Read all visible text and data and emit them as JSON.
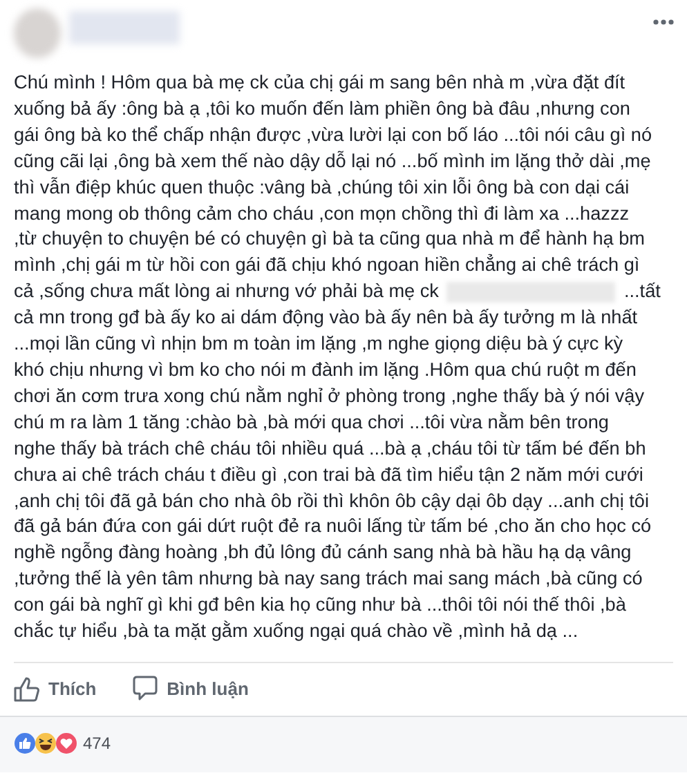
{
  "post": {
    "lines": [
      {
        "text": "Chú mình ! Hôm qua bà mẹ ck của chị gái m sang bên nhà m ,vừa đặt đít"
      },
      {
        "text": "xuống bả ấy :ông bà ạ ,tôi ko muốn đến làm phiền ông bà đâu ,nhưng con"
      },
      {
        "text": "gái ông bà ko thể chấp nhận được ,vừa lười lại con bố láo ...tôi nói câu gì nó"
      },
      {
        "text": "cũng cãi lại ,ông bà xem thế nào dậy dỗ lại nó ...bố mình im lặng thở dài ,mẹ"
      },
      {
        "text": "thì vẫn điệp khúc quen thuộc :vâng bà ,chúng tôi xin lỗi ông bà con dại cái"
      },
      {
        "text": "mang mong ob thông cảm cho cháu ,con mọn chồng thì đi làm xa ...hazzz"
      },
      {
        "text": ",từ chuyện to chuyện bé có chuyện gì bà ta cũng qua nhà m để hành hạ bm"
      },
      {
        "text": "mình ,chị gái m từ hồi con gái đã chịu khó ngoan hiền chẳng ai chê trách gì"
      },
      {
        "text": "cả ,sống chưa mất lòng ai nhưng vớ phải bà mẹ ck",
        "redacted": true,
        "text_after": "...tất"
      },
      {
        "text": "cả mn trong gđ bà ấy ko ai dám động vào bà ấy nên bà ấy tưởng m là nhất"
      },
      {
        "text": "...mọi lần cũng vì nhịn bm m toàn im lặng ,m nghe giọng diệu bà ý cực kỳ"
      },
      {
        "text": "khó chịu nhưng vì bm ko cho nói m đành im lặng .Hôm qua chú ruột m đến"
      },
      {
        "text": "chơi ăn cơm trưa xong chú nằm nghỉ ở phòng trong ,nghe thấy bà ý nói vậy"
      },
      {
        "text": "chú m ra làm 1 tăng :chào bà ,bà mới qua chơi ...tôi vừa nằm bên trong"
      },
      {
        "text": "nghe thấy bà trách chê cháu tôi nhiều quá ...bà ạ ,cháu tôi từ tấm bé đến bh"
      },
      {
        "text": "chưa ai chê trách cháu t điều gì ,con trai bà đã tìm hiểu tận 2 năm mới cưới"
      },
      {
        "text": ",anh chị tôi đã gả bán cho nhà ôb rồi thì khôn ôb cậy dại ôb dạy ...anh chị tôi"
      },
      {
        "text": "đã gả bán đứa con gái dứt ruột đẻ ra nuôi lấng từ tấm bé ,cho ăn cho học có"
      },
      {
        "text": "nghề ngỗng đàng hoàng ,bh đủ lông đủ cánh sang nhà bà hầu hạ dạ vâng"
      },
      {
        "text": ",tưởng thế là yên tâm nhưng bà nay sang trách mai sang mách ,bà cũng có"
      },
      {
        "text": "con gái bà nghĩ gì khi gđ bên kia họ cũng như bà ...thôi tôi nói thế thôi ,bà"
      },
      {
        "text": "chắc tự hiểu ,bà ta mặt gằm xuống ngại quá chào về ,mình hả dạ ..."
      }
    ]
  },
  "actions": [
    {
      "kind": "like",
      "label": "Thích"
    },
    {
      "kind": "comment",
      "label": "Bình luận"
    }
  ],
  "reactions": {
    "icons": [
      {
        "kind": "like"
      },
      {
        "kind": "haha"
      },
      {
        "kind": "love"
      }
    ],
    "count": "474"
  }
}
